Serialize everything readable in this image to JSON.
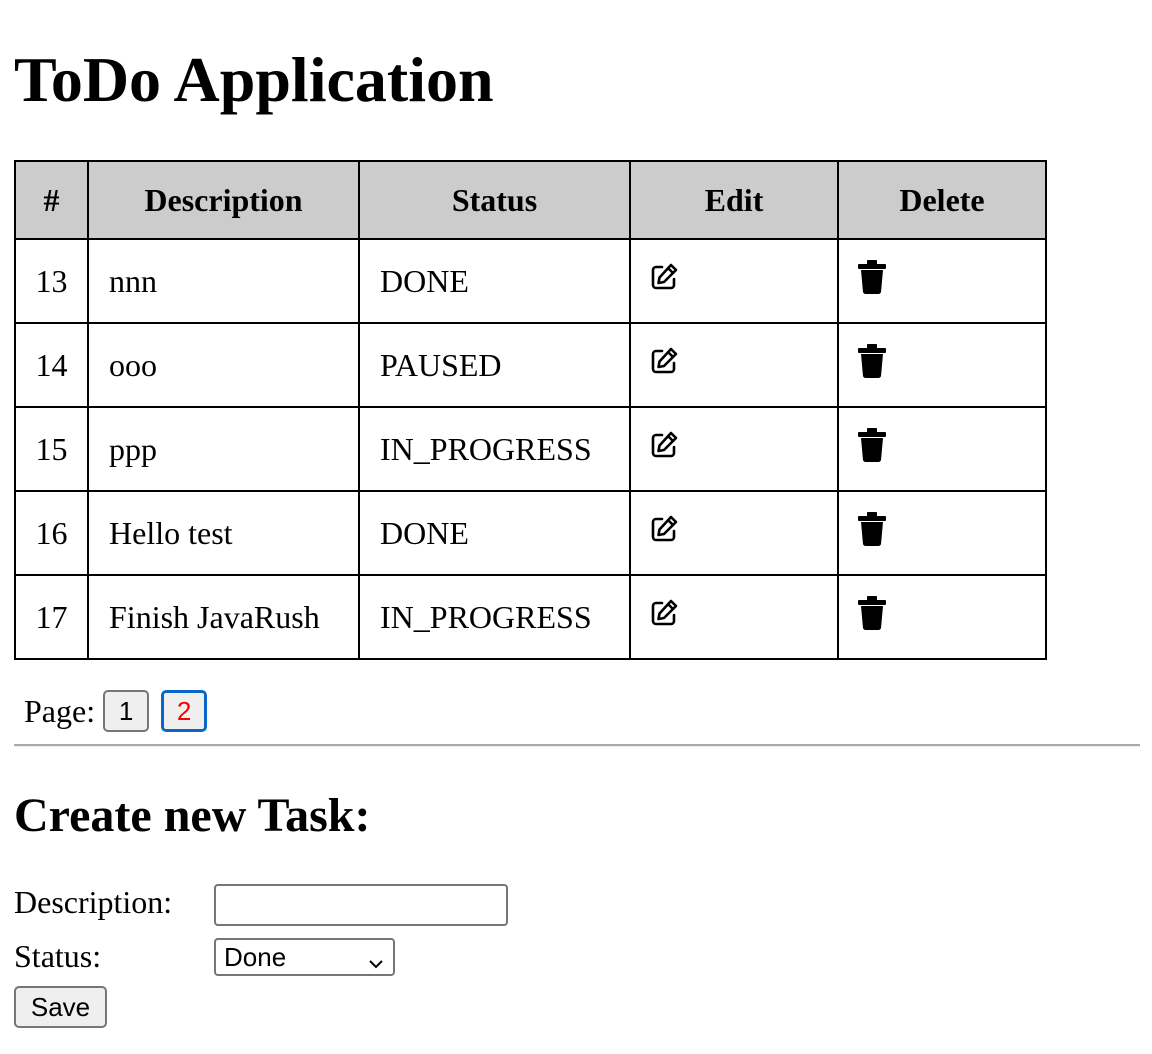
{
  "header": {
    "title": "ToDo Application"
  },
  "table": {
    "columns": [
      "#",
      "Description",
      "Status",
      "Edit",
      "Delete"
    ],
    "edit_icon": "edit-pencil-icon",
    "delete_icon": "trash-icon",
    "rows": [
      {
        "id": "13",
        "description": "nnn",
        "status": "DONE"
      },
      {
        "id": "14",
        "description": "ooo",
        "status": "PAUSED"
      },
      {
        "id": "15",
        "description": "ppp",
        "status": "IN_PROGRESS"
      },
      {
        "id": "16",
        "description": "Hello test",
        "status": "DONE"
      },
      {
        "id": "17",
        "description": "Finish JavaRush",
        "status": "IN_PROGRESS"
      }
    ]
  },
  "pagination": {
    "label": "Page:",
    "pages": [
      "1",
      "2"
    ],
    "current": "2",
    "current_color": "#ff0000",
    "focus_color": "#0a66c8"
  },
  "create_form": {
    "title": "Create new Task:",
    "description_label": "Description:",
    "description_value": "",
    "status_label": "Status:",
    "status_selected": "Done",
    "save_label": "Save"
  },
  "colors": {
    "header_background": "#cccccc",
    "border": "#000000"
  }
}
